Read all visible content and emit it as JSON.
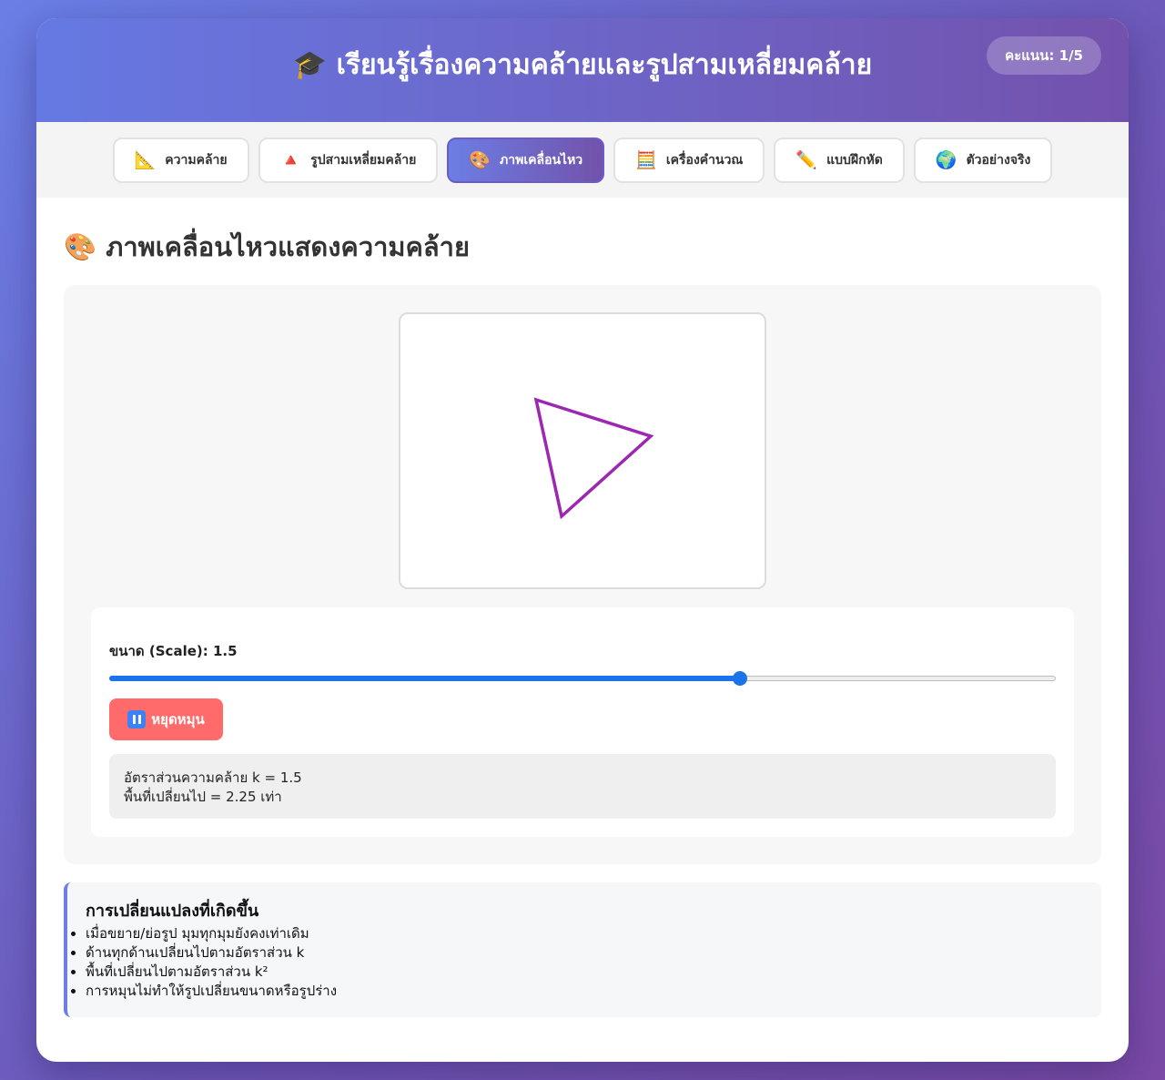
{
  "header": {
    "title": "🎓 เรียนรู้เรื่องความคล้ายและรูปสามเหลี่ยมคล้าย",
    "score": "คะแนน: 1/5"
  },
  "tabs": [
    {
      "icon": "📐",
      "label": "ความคล้าย",
      "active": false
    },
    {
      "icon": "🔺",
      "label": "รูปสามเหลี่ยมคล้าย",
      "active": false
    },
    {
      "icon": "🎨",
      "label": "ภาพเคลื่อนไหว",
      "active": true
    },
    {
      "icon": "🧮",
      "label": "เครื่องคำนวณ",
      "active": false
    },
    {
      "icon": "✏️",
      "label": "แบบฝึกหัด",
      "active": false
    },
    {
      "icon": "🌍",
      "label": "ตัวอย่างจริง",
      "active": false
    }
  ],
  "main": {
    "title": "🎨 ภาพเคลื่อนไหวแสดงความคล้าย",
    "triangle_color": "#9c27b0",
    "scale_label": "ขนาด (Scale): 1.5",
    "slider": {
      "min": 0.5,
      "max": 2,
      "value": 1.5
    },
    "pause_label": "หยุดหมุน",
    "ratio_text": "อัตราส่วนความคล้าย k = 1.5",
    "area_text": "พื้นที่เปลี่ยนไป = 2.25 เท่า"
  },
  "changes": {
    "title": "การเปลี่ยนแปลงที่เกิดขึ้น",
    "items": [
      "เมื่อขยาย/ย่อรูป มุมทุกมุมยังคงเท่าเดิม",
      "ด้านทุกด้านเปลี่ยนไปตามอัตราส่วน k",
      "พื้นที่เปลี่ยนไปตามอัตราส่วน k²",
      "การหมุนไม่ทำให้รูปเปลี่ยนขนาดหรือรูปร่าง"
    ]
  }
}
